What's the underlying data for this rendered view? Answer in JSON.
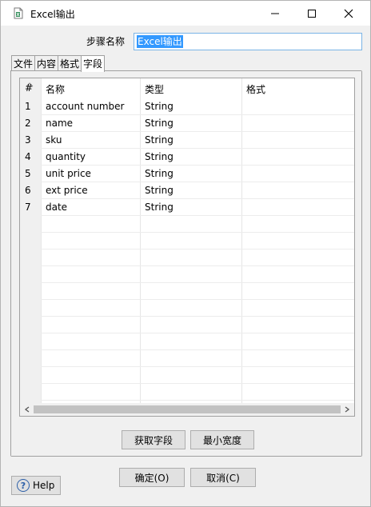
{
  "window": {
    "title": "Excel输出"
  },
  "step": {
    "label": "步骤名称",
    "value": "Excel输出"
  },
  "tabs": [
    {
      "label": "文件",
      "active": false
    },
    {
      "label": "内容",
      "active": false
    },
    {
      "label": "格式",
      "active": false
    },
    {
      "label": "字段",
      "active": true
    }
  ],
  "table": {
    "headers": [
      "#",
      "名称",
      "类型",
      "格式"
    ],
    "rows": [
      {
        "num": "1",
        "name": "account number",
        "type": "String",
        "format": ""
      },
      {
        "num": "2",
        "name": "name",
        "type": "String",
        "format": ""
      },
      {
        "num": "3",
        "name": "sku",
        "type": "String",
        "format": ""
      },
      {
        "num": "4",
        "name": "quantity",
        "type": "String",
        "format": ""
      },
      {
        "num": "5",
        "name": "unit price",
        "type": "String",
        "format": ""
      },
      {
        "num": "6",
        "name": "ext price",
        "type": "String",
        "format": ""
      },
      {
        "num": "7",
        "name": "date",
        "type": "String",
        "format": ""
      }
    ]
  },
  "buttons": {
    "get_fields": "获取字段",
    "min_width": "最小宽度",
    "ok": "确定(O)",
    "cancel": "取消(C)",
    "help": "Help"
  },
  "colors": {
    "selection": "#3399ff",
    "input_border": "#7ab4e6",
    "help_icon": "#2c5fa8"
  }
}
